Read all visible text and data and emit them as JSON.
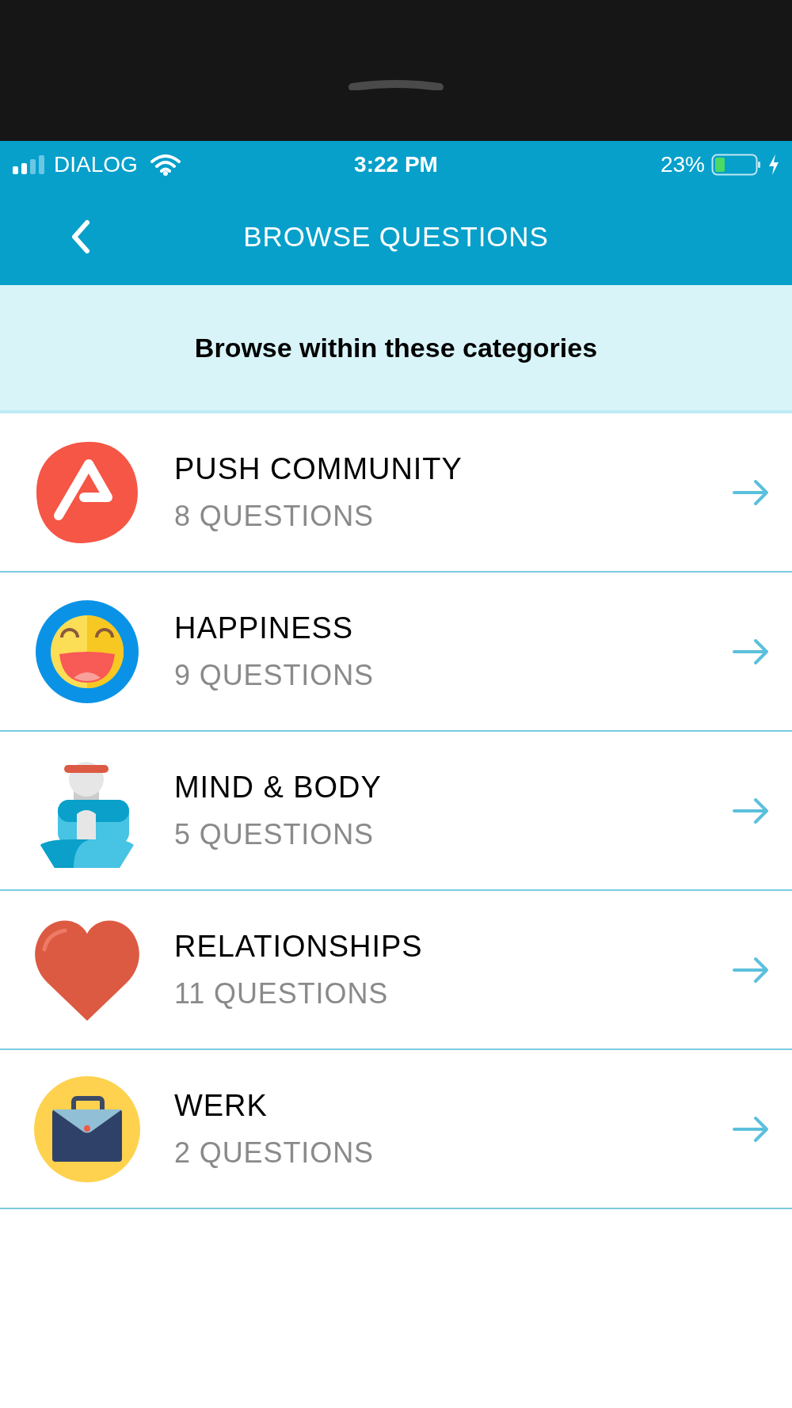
{
  "status_bar": {
    "carrier": "DIALOG",
    "time": "3:22 PM",
    "battery": "23%"
  },
  "nav": {
    "title": "BROWSE QUESTIONS"
  },
  "banner": {
    "text": "Browse within these categories"
  },
  "categories": [
    {
      "kind": "community",
      "name": "PUSH COMMUNITY",
      "count": "8 QUESTIONS"
    },
    {
      "kind": "happiness",
      "name": "HAPPINESS",
      "count": "9 QUESTIONS"
    },
    {
      "kind": "mind",
      "name": "MIND & BODY",
      "count": "5 QUESTIONS"
    },
    {
      "kind": "relationships",
      "name": "RELATIONSHIPS",
      "count": "11 QUESTIONS"
    },
    {
      "kind": "work",
      "name": "WERK",
      "count": "2 QUESTIONS"
    }
  ]
}
